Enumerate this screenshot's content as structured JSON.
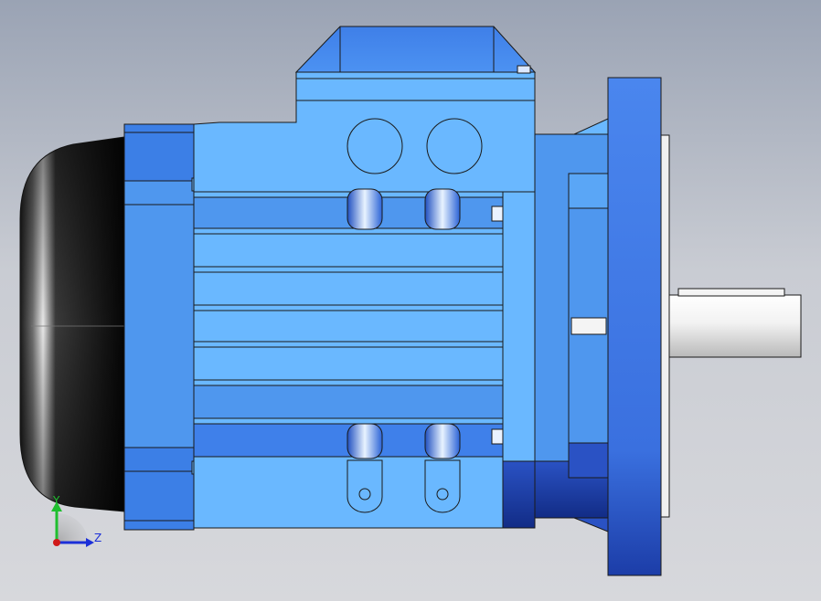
{
  "scene": {
    "model": "electric-motor-side-view",
    "colors": {
      "body": "#6ab8ff",
      "body_mid": "#4f97ee",
      "body_dark": "#2d5fd0",
      "fan_cover": "#0b0b0b",
      "shaft": "#e4e4e4",
      "outline": "#1a1a1a"
    }
  },
  "triad": {
    "y_label": "Y",
    "z_label": "Z",
    "y_color": "#1fbf2f",
    "z_color": "#1b2fd8",
    "origin_color": "#d01919"
  }
}
